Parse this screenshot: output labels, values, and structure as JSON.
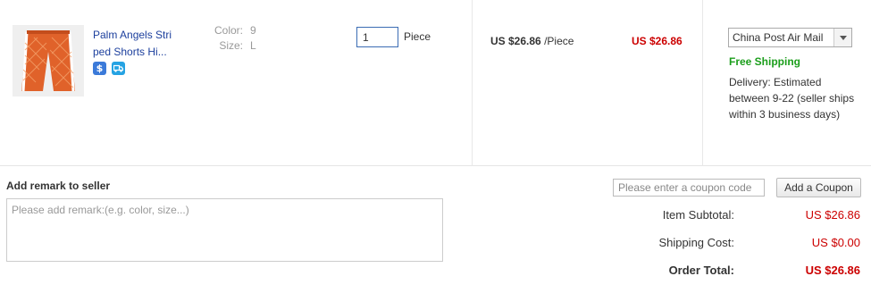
{
  "item": {
    "name": "Palm Angels Striped Shorts Hi...",
    "name_line1": "Palm Angels Stri",
    "name_line2": "ped Shorts Hi...",
    "badges": [
      "dollar-badge-icon",
      "shipping-badge-icon"
    ],
    "attributes": [
      {
        "key": "Color:",
        "value": "9"
      },
      {
        "key": "Size:",
        "value": "L"
      }
    ],
    "quantity": "1",
    "quantity_unit": "Piece",
    "unit_price": "US $26.86",
    "unit_price_suffix": "/Piece",
    "line_total": "US $26.86"
  },
  "shipping": {
    "method": "China Post Air Mail",
    "free_label": "Free Shipping",
    "delivery_text": "Delivery: Estimated between 9-22 (seller ships within 3 business days)"
  },
  "remark": {
    "label": "Add remark to seller",
    "placeholder": "Please add remark:(e.g. color, size...)"
  },
  "coupon": {
    "placeholder": "Please enter a coupon code",
    "button_label": "Add a Coupon"
  },
  "summary": {
    "subtotal_label": "Item Subtotal:",
    "subtotal_value": "US $26.86",
    "shipping_label": "Shipping Cost:",
    "shipping_value": "US $0.00",
    "total_label": "Order Total:",
    "total_value": "US $26.86"
  },
  "colors": {
    "price_red": "#cc0000",
    "link_blue": "#1c3f9d",
    "free_green": "#1b9e1b"
  }
}
